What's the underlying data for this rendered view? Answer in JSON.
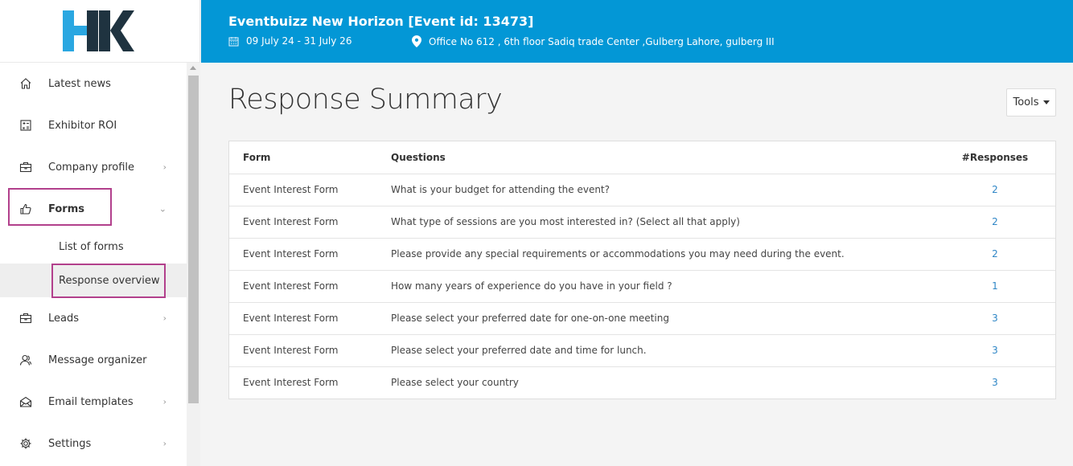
{
  "sidebar": {
    "logo_text": "HK",
    "items": [
      {
        "label": "Latest news",
        "icon": "home-icon"
      },
      {
        "label": "Exhibitor ROI",
        "icon": "calculator-icon"
      },
      {
        "label": "Company profile",
        "icon": "briefcase-icon",
        "chevron": "right"
      },
      {
        "label": "Forms",
        "icon": "thumbs-up-icon",
        "chevron": "down",
        "expanded": true
      },
      {
        "label": "Leads",
        "icon": "briefcase-icon",
        "chevron": "right"
      },
      {
        "label": "Message organizer",
        "icon": "users-icon"
      },
      {
        "label": "Email templates",
        "icon": "envelope-open-icon",
        "chevron": "right"
      },
      {
        "label": "Settings",
        "icon": "gear-icon",
        "chevron": "right"
      }
    ],
    "forms_sub": [
      {
        "label": "List of forms"
      },
      {
        "label": "Response overview",
        "active": true
      }
    ]
  },
  "header": {
    "title": "Eventbuizz New Horizon [Event id: 13473]",
    "date": "09 July 24 - 31 July 26",
    "location": "Office No 612 , 6th floor Sadiq trade Center ,Gulberg Lahore, gulberg III",
    "background_color": "#0397d6"
  },
  "main": {
    "title": "Response Summary",
    "tools_label": "Tools",
    "table": {
      "headers": [
        "Form",
        "Questions",
        "#Responses"
      ],
      "rows": [
        [
          "Event Interest Form",
          "What is your budget for attending the event?",
          "2"
        ],
        [
          "Event Interest Form",
          "What type of sessions are you most interested in? (Select all that apply)",
          "2"
        ],
        [
          "Event Interest Form",
          "Please provide any special requirements or accommodations you may need during the event.",
          "2"
        ],
        [
          "Event Interest Form",
          "How many years of experience do you have in your field ?",
          "1"
        ],
        [
          "Event Interest Form",
          "Please select your preferred date for one-on-one meeting",
          "3"
        ],
        [
          "Event Interest Form",
          "Please select your preferred date and time for lunch.",
          "3"
        ],
        [
          "Event Interest Form",
          "Please select your country",
          "3"
        ]
      ]
    }
  },
  "colors": {
    "accent": "#0397d6",
    "link": "#2f86c6",
    "highlight_border": "#b2408c"
  }
}
